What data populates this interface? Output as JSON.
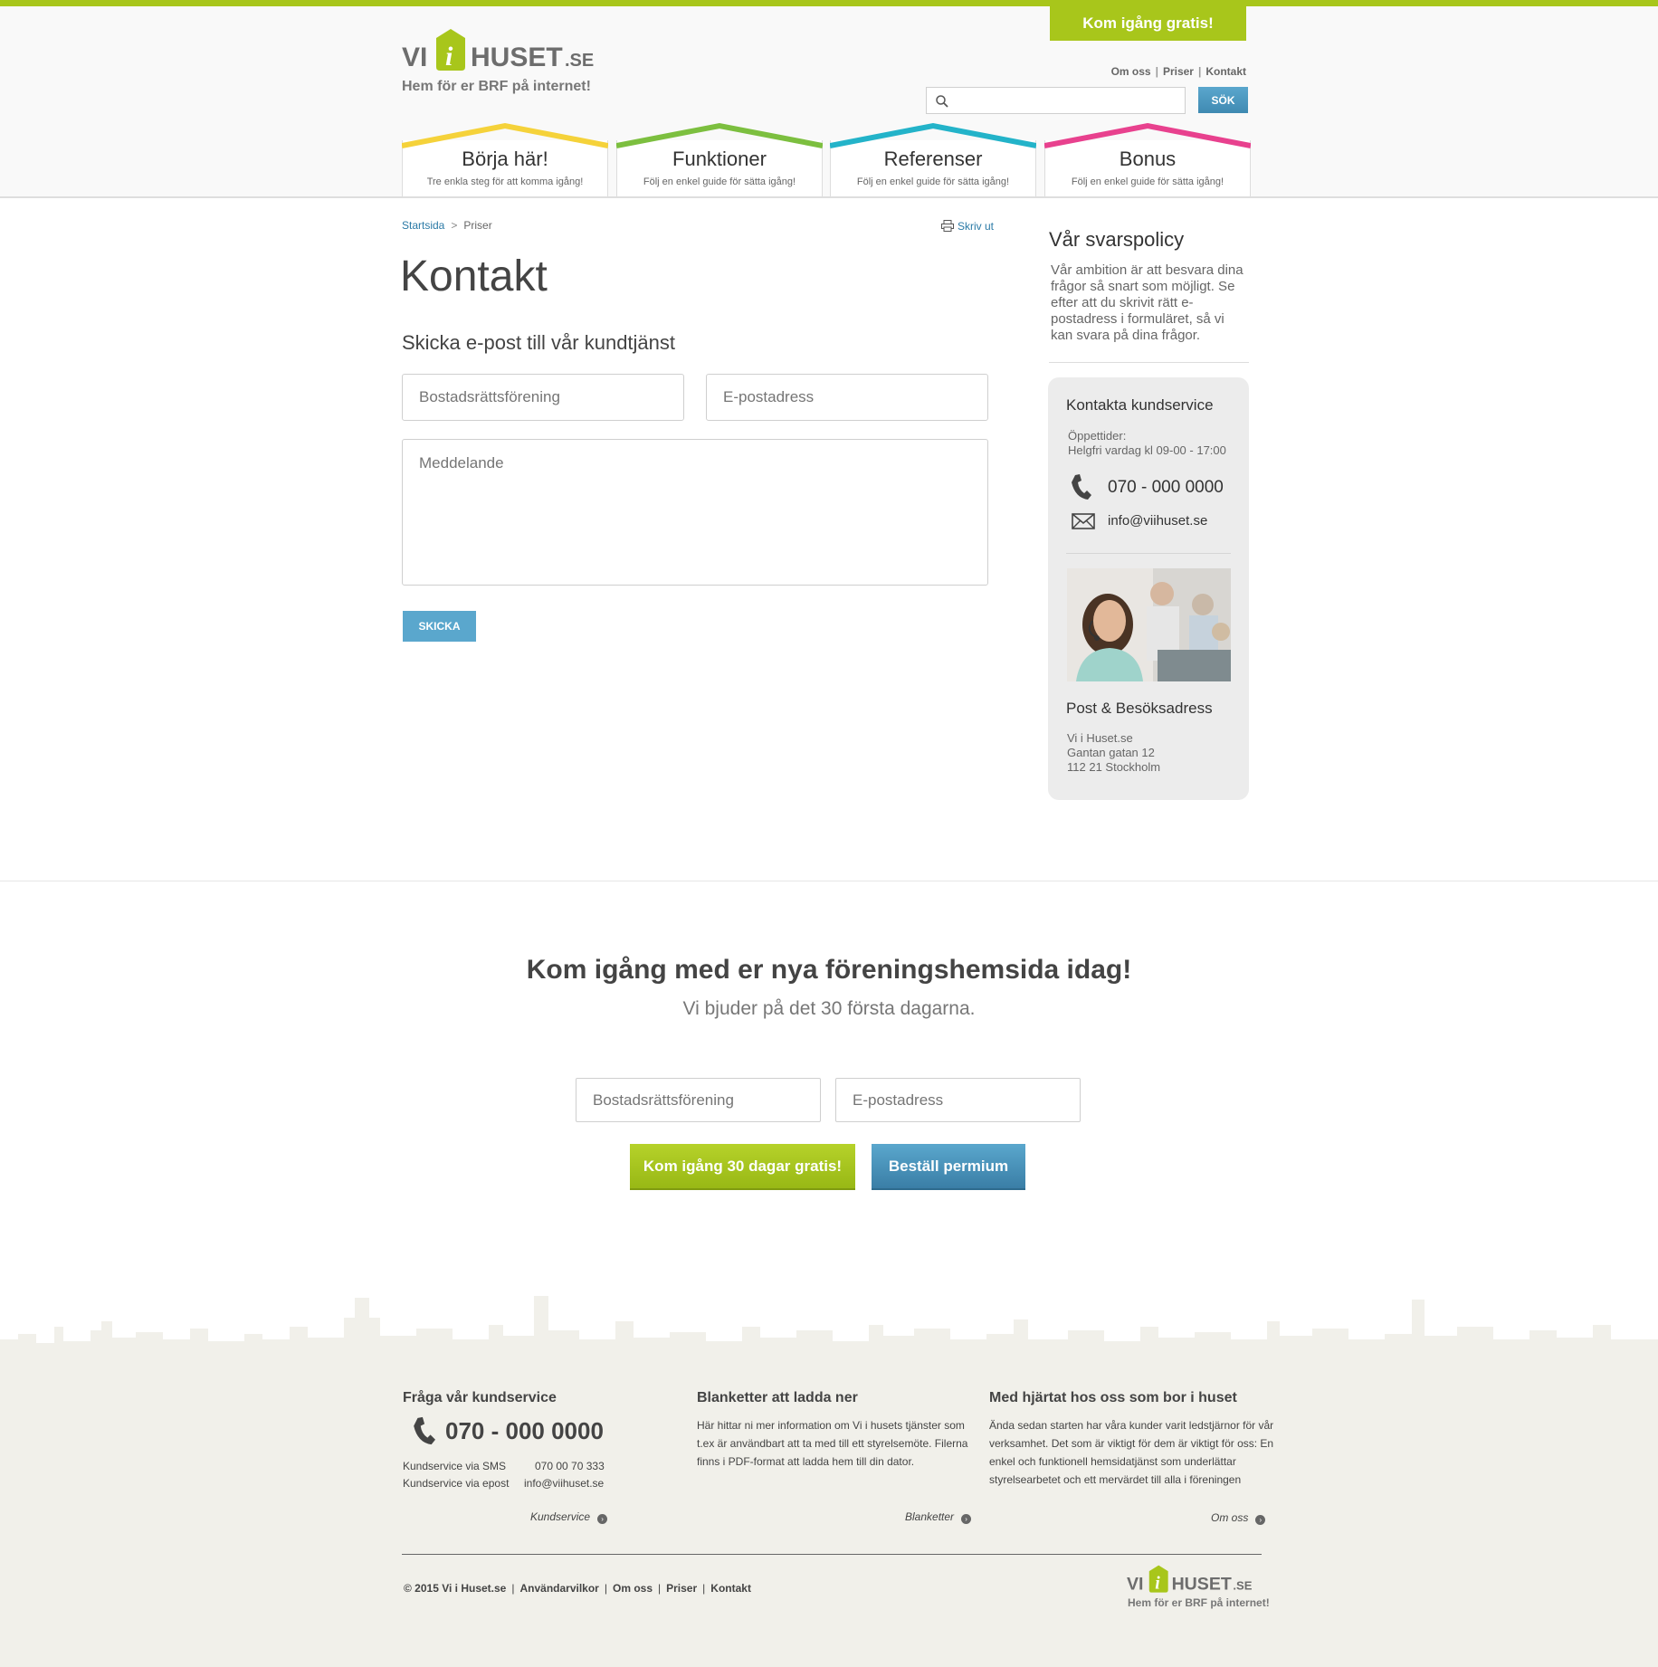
{
  "header": {
    "cta": "Kom igång gratis!",
    "logo_text": "VI i HUSET.SE",
    "tagline": "Hem för er BRF på internet!",
    "toplinks": [
      "Om oss",
      "Priser",
      "Kontakt"
    ],
    "search_placeholder": "",
    "search_button": "SÖK",
    "tabs": [
      {
        "title": "Börja här!",
        "subtitle": "Tre enkla steg för att komma igång!",
        "color": "#f5d23a"
      },
      {
        "title": "Funktioner",
        "subtitle": "Följ en enkel guide för sätta igång!",
        "color": "#7cbf3f"
      },
      {
        "title": "Referenser",
        "subtitle": "Följ en enkel guide för sätta igång!",
        "color": "#23b3c9"
      },
      {
        "title": "Bonus",
        "subtitle": "Följ en enkel guide för sätta igång!",
        "color": "#e8418e"
      }
    ]
  },
  "breadcrumb": {
    "home": "Startsida",
    "separator": ">",
    "current": "Priser"
  },
  "print_label": "Skriv ut",
  "page_title": "Kontakt",
  "form": {
    "heading": "Skicka e-post till vår kundtjänst",
    "brf_placeholder": "Bostadsrättsförening",
    "email_placeholder": "E-postadress",
    "message_placeholder": "Meddelande",
    "submit": "SKICKA"
  },
  "sidebar": {
    "policy_title": "Vår svarspolicy",
    "policy_text": "Vår ambition är att besvara dina frågor så snart som möjligt. Se efter att du skrivit rätt e-postadress i formuläret, så vi kan svara på dina frågor.",
    "contact_title": "Kontakta kundservice",
    "hours_label": "Öppettider:",
    "hours_value": "Helgfri vardag kl 09-00 - 17:00",
    "phone": "070 - 000 0000",
    "email": "info@viihuset.se",
    "address_title": "Post & Besöksadress",
    "address_lines": [
      "Vi i Huset.se",
      "Gantan gatan 12",
      "112 21 Stockholm"
    ]
  },
  "promo": {
    "title": "Kom igång med er nya föreningshemsida idag!",
    "subtitle": "Vi bjuder på det 30 första dagarna.",
    "brf_placeholder": "Bostadsrättsförening",
    "email_placeholder": "E-postadress",
    "primary_button": "Kom igång 30 dagar gratis!",
    "secondary_button": "Beställ permium"
  },
  "footer": {
    "col1_title": "Fråga vår kundservice",
    "phone": "070 - 000 0000",
    "sms_label": "Kundservice via SMS",
    "sms_value": "070 00 70 333",
    "epost_label": "Kundservice via epost",
    "epost_value": "info@viihuset.se",
    "col1_link": "Kundservice",
    "col2_title": "Blanketter att ladda ner",
    "col2_text": "Här hittar ni mer information om Vi i husets tjänster som t.ex är användbart att ta med till ett styrelsemöte. Filerna finns i PDF-format att ladda hem till din dator.",
    "col2_link": "Blanketter",
    "col3_title": "Med hjärtat hos oss som bor i huset",
    "col3_text": "Ända sedan starten har våra kunder varit ledstjärnor för vår verksamhet. Det som är viktigt för dem är viktigt för oss: En enkel och funktionell hemsidatjänst som underlättar styrelsearbetet och ett mervärdet till alla i föreningen",
    "col3_link": "Om oss",
    "copyright": "© 2015 Vi i Huset.se",
    "bottom_links": [
      "Användarvilkor",
      "Om oss",
      "Priser",
      "Kontakt"
    ],
    "tagline": "Hem för er BRF på internet!"
  }
}
